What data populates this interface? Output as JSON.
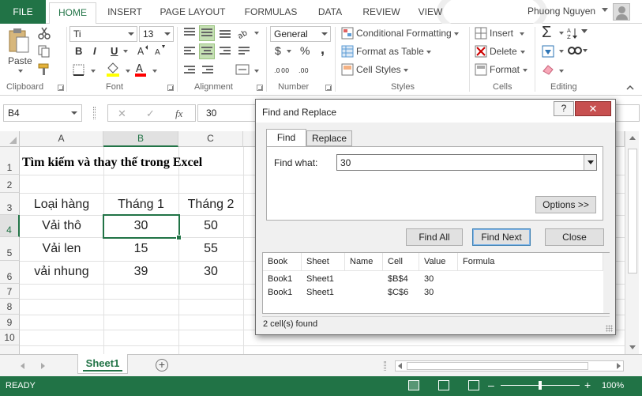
{
  "ribbon_tabs": [
    "FILE",
    "HOME",
    "INSERT",
    "PAGE LAYOUT",
    "FORMULAS",
    "DATA",
    "REVIEW",
    "VIEW"
  ],
  "user": {
    "name": "Phuong Nguyen"
  },
  "clipboard": {
    "paste_label": "Paste",
    "group_label": "Clipboard"
  },
  "font": {
    "name": "Ti",
    "size": "13",
    "bold": "B",
    "italic": "I",
    "underline": "U",
    "group_label": "Font"
  },
  "alignment": {
    "group_label": "Alignment"
  },
  "number": {
    "format": "General",
    "currency": "$",
    "percent": "%",
    "comma": ",",
    "group_label": "Number"
  },
  "styles": {
    "conditional": "Conditional Formatting",
    "table": "Format as Table",
    "cell_styles": "Cell Styles",
    "group_label": "Styles"
  },
  "cells": {
    "insert": "Insert",
    "delete": "Delete",
    "format": "Format",
    "group_label": "Cells"
  },
  "editing": {
    "group_label": "Editing"
  },
  "formula_bar": {
    "name_box": "B4",
    "value": "30",
    "fx": "fx"
  },
  "columns": [
    "A",
    "B",
    "C"
  ],
  "rows": [
    "1",
    "2",
    "3",
    "4",
    "5",
    "6",
    "7",
    "8",
    "9",
    "10"
  ],
  "sheet": {
    "title": "Tìm kiếm và thay thế trong Excel",
    "header": [
      "Loại hàng",
      "Tháng 1",
      "Tháng 2"
    ],
    "data": [
      [
        "Vải thô",
        "30",
        "50"
      ],
      [
        "Vải len",
        "15",
        "55"
      ],
      [
        "vải nhung",
        "39",
        "30"
      ]
    ]
  },
  "sheet_tabs": [
    "Sheet1"
  ],
  "status": {
    "ready": "READY",
    "zoom": "100%"
  },
  "dialog": {
    "title": "Find and Replace",
    "help": "?",
    "close": "✕",
    "tabs": [
      "Find",
      "Replace"
    ],
    "find_label": "Find what:",
    "find_value": "30",
    "options_button": "Options >>",
    "find_all": "Find All",
    "find_next": "Find Next",
    "close_button": "Close",
    "result_headers": [
      "Book",
      "Sheet",
      "Name",
      "Cell",
      "Value",
      "Formula"
    ],
    "results": [
      [
        "Book1",
        "Sheet1",
        "",
        "$B$4",
        "30",
        ""
      ],
      [
        "Book1",
        "Sheet1",
        "",
        "$C$6",
        "30",
        ""
      ]
    ],
    "found_text": "2 cell(s) found"
  },
  "colors": {
    "accent": "#217346",
    "close_red": "#c75050"
  }
}
